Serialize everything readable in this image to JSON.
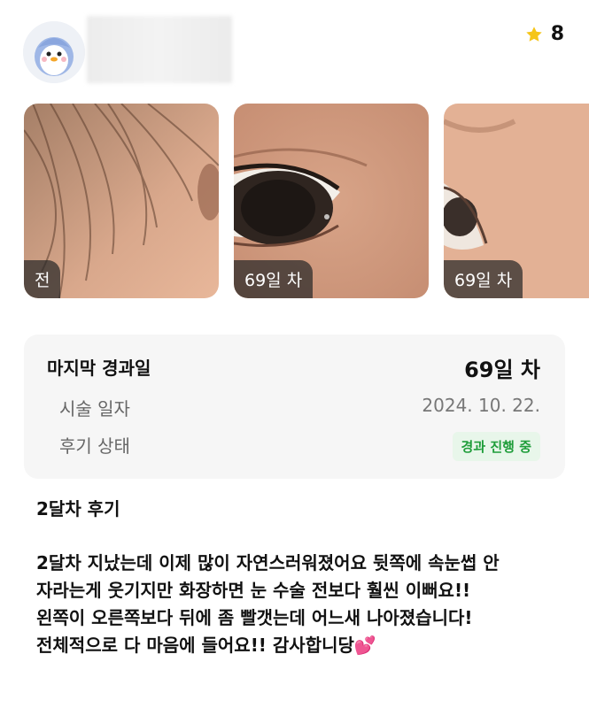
{
  "header": {
    "rating_value": "8",
    "colors": {
      "star": "#f5c518"
    }
  },
  "gallery": {
    "photos": [
      {
        "label": "전",
        "icon": "photo-before"
      },
      {
        "label": "69일 차",
        "icon": "photo-eye"
      },
      {
        "label": "69일 차",
        "icon": "photo-eye-side"
      }
    ]
  },
  "info": {
    "last_day_label": "마지막 경과일",
    "last_day_value": "69일 차",
    "procedure_date_label": "시술 일자",
    "procedure_date_value": "2024. 10. 22.",
    "status_label": "후기 상태",
    "status_value": "경과 진행 중",
    "colors": {
      "badge_text": "#1f9d3a",
      "badge_bg": "#e8f6ea"
    }
  },
  "review": {
    "title": "2달차 후기",
    "lines": [
      "2달차 지났는데 이제 많이 자연스러워졌어요 뒷쪽에 속눈썹 안",
      "자라는게 웃기지만 화장하면 눈 수술 전보다 훨씬 이뻐요!!",
      "왼쪽이 오른쪽보다 뒤에 좀 빨갯는데 어느새 나아졌습니다!",
      "전체적으로 다 마음에 들어요!! 감사합니당💕"
    ]
  }
}
